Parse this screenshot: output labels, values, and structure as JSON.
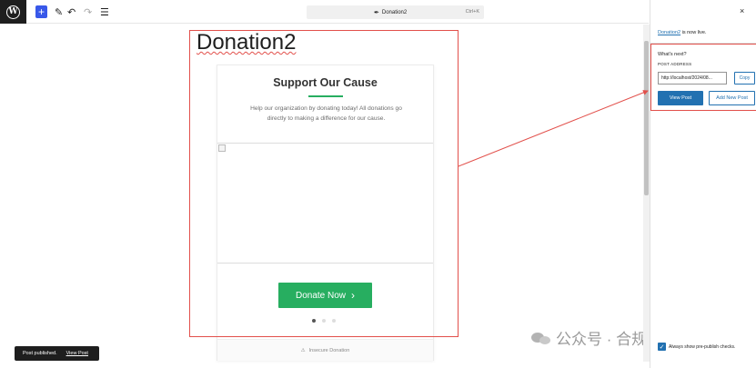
{
  "toolbar": {
    "wp_logo": "W",
    "add_icon": "+",
    "tools_icon": "✎",
    "undo_icon": "↶",
    "redo_icon": "↷",
    "list_view_icon": "☰",
    "command_title": "Donation2",
    "command_shortcut": "Ctrl+K"
  },
  "editor": {
    "post_title": "Donation2",
    "card": {
      "title": "Support Our Cause",
      "description": "Help our organization by donating today! All donations go directly to making a difference for our cause.",
      "button_label": "Donate Now",
      "button_chevron": "›",
      "footer_text": "Insecure Donation",
      "footer_icon": "⚠"
    }
  },
  "snackbar": {
    "message": "Post published.",
    "action": "View Post"
  },
  "watermark": {
    "text": "公众号 · 合规渗透"
  },
  "panel": {
    "close_icon": "×",
    "post_link": "Donation2",
    "live_suffix": " is now live.",
    "whats_next": "What's next?",
    "post_address_label": "POST ADDRESS",
    "post_address_value": "http://localhost/2024/08...",
    "copy_label": "Copy",
    "view_post_label": "View Post",
    "add_new_label": "Add New Post",
    "prepublish_label": "Always show pre-publish checks.",
    "prepublish_checked": true
  },
  "colors": {
    "accent": "#2271b1",
    "donate_green": "#27ae60",
    "highlight_red": "#e2504b"
  }
}
